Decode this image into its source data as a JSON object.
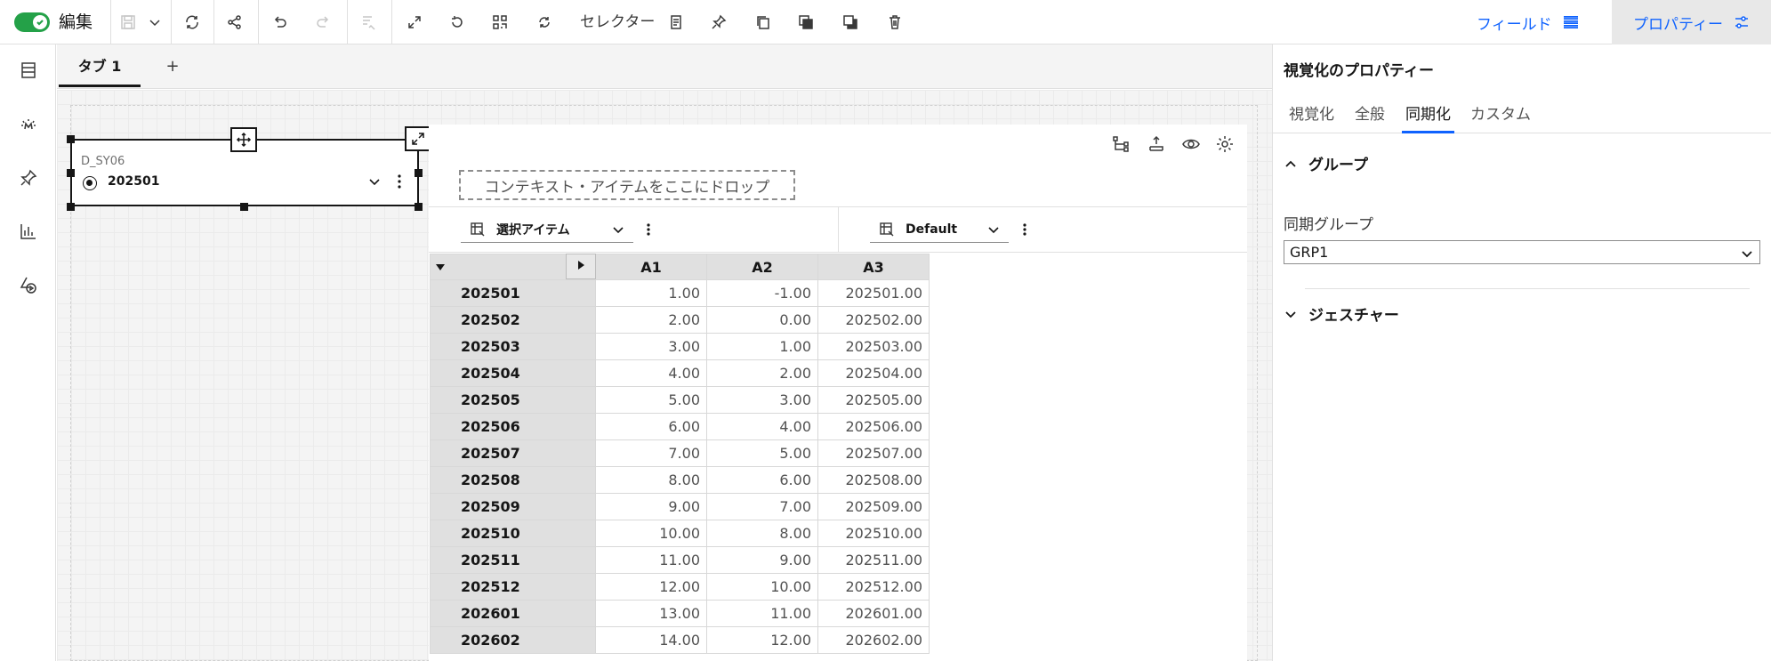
{
  "toolbar": {
    "edit_label": "編集",
    "selector_label": "セレクター",
    "fields_label": "フィールド",
    "properties_label": "プロパティー"
  },
  "tabs": {
    "active_label": "タブ 1",
    "add_label": "+"
  },
  "filter_widget": {
    "label": "D_SY06",
    "value": "202501"
  },
  "crosstab": {
    "dropzone_text": "コンテキスト・アイテムをここにドロップ",
    "row_edge_label": "選択アイテム",
    "col_edge_label": "Default",
    "columns": [
      "A1",
      "A2",
      "A3"
    ],
    "rows": [
      {
        "label": "202501",
        "values": [
          "1.00",
          "-1.00",
          "202501.00"
        ]
      },
      {
        "label": "202502",
        "values": [
          "2.00",
          "0.00",
          "202502.00"
        ]
      },
      {
        "label": "202503",
        "values": [
          "3.00",
          "1.00",
          "202503.00"
        ]
      },
      {
        "label": "202504",
        "values": [
          "4.00",
          "2.00",
          "202504.00"
        ]
      },
      {
        "label": "202505",
        "values": [
          "5.00",
          "3.00",
          "202505.00"
        ]
      },
      {
        "label": "202506",
        "values": [
          "6.00",
          "4.00",
          "202506.00"
        ]
      },
      {
        "label": "202507",
        "values": [
          "7.00",
          "5.00",
          "202507.00"
        ]
      },
      {
        "label": "202508",
        "values": [
          "8.00",
          "6.00",
          "202508.00"
        ]
      },
      {
        "label": "202509",
        "values": [
          "9.00",
          "7.00",
          "202509.00"
        ]
      },
      {
        "label": "202510",
        "values": [
          "10.00",
          "8.00",
          "202510.00"
        ]
      },
      {
        "label": "202511",
        "values": [
          "11.00",
          "9.00",
          "202511.00"
        ]
      },
      {
        "label": "202512",
        "values": [
          "12.00",
          "10.00",
          "202512.00"
        ]
      },
      {
        "label": "202601",
        "values": [
          "13.00",
          "11.00",
          "202601.00"
        ]
      },
      {
        "label": "202602",
        "values": [
          "14.00",
          "12.00",
          "202602.00"
        ]
      }
    ]
  },
  "properties": {
    "title": "視覚化のプロパティー",
    "tabs": [
      "視覚化",
      "全般",
      "同期化",
      "カスタム"
    ],
    "active_tab": "同期化",
    "group_section": "グループ",
    "sync_group_label": "同期グループ",
    "sync_group_value": "GRP1",
    "gesture_section": "ジェスチャー"
  },
  "colors": {
    "accent": "#0f62fe",
    "toggle_on": "#24a148"
  }
}
